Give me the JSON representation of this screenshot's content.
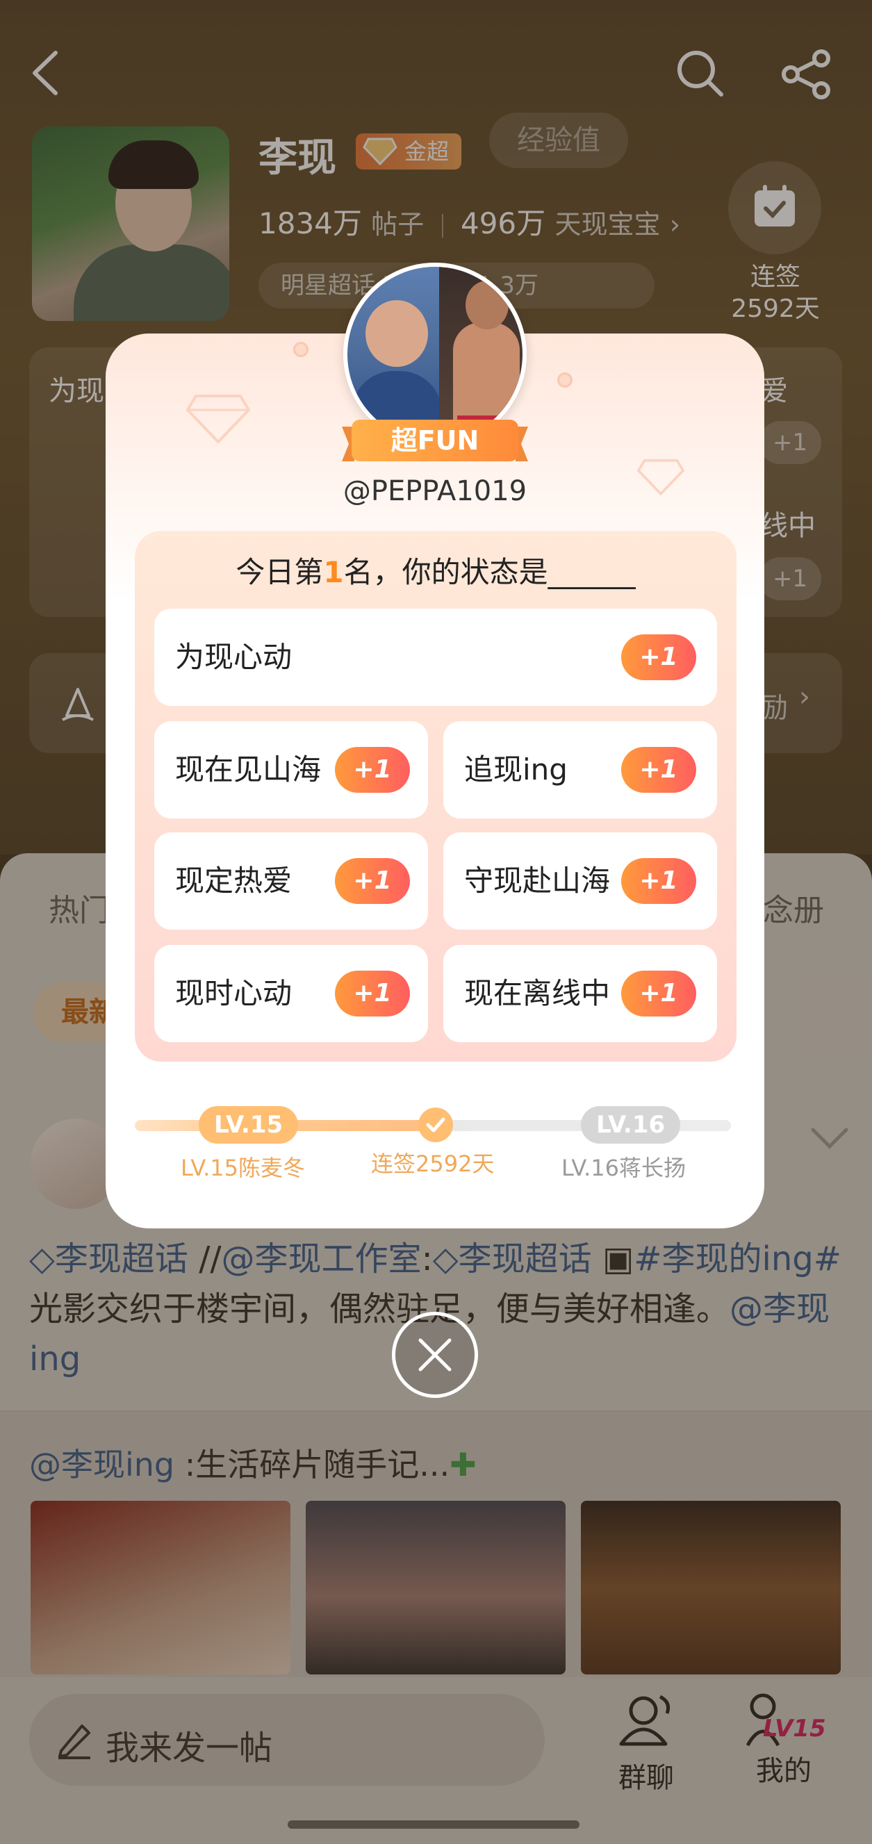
{
  "header": {
    "profile_name": "李现",
    "gold_badge": "金超",
    "exp_label": "经验值"
  },
  "stats": {
    "posts_count": "1834万",
    "posts_label": "帖子",
    "fans_count": "496万",
    "fans_label": "天现宝宝"
  },
  "tags": {
    "text": "明星超话  实时热度1.3万"
  },
  "checkin": {
    "label": "连签",
    "days": "2592天"
  },
  "background_cards": {
    "left_title": "为现",
    "right_1": "爱",
    "right_2": "线中",
    "plus": "+1",
    "activity_suffix": "励"
  },
  "feed": {
    "tab_hot": "热门",
    "tab_album": "念册",
    "pill_latest": "最新",
    "post_text_parts": [
      "李现超话",
      " //",
      "@李现工作室",
      ":",
      "李现超话",
      " ",
      "#李现的ing#",
      " 光影交织于楼宇间，偶然驻足，便与美好相逢。",
      "@李现ing"
    ],
    "repost_user": "@李现ing",
    "repost_text": " :生活碎片随手记..."
  },
  "bottom": {
    "compose_label": "我来发一帖",
    "group_chat": "群聊",
    "mine": "我的",
    "mine_level": "LV15"
  },
  "modal": {
    "badge": "超FUN",
    "handle": "@PEPPA1019",
    "title_prefix": "今日第",
    "title_rank": "1",
    "title_suffix": "名，你的状态是______",
    "options": [
      {
        "label": "为现心动",
        "plus": "+1"
      },
      {
        "label": "现在见山海",
        "plus": "+1"
      },
      {
        "label": "追现ing",
        "plus": "+1"
      },
      {
        "label": "现定热爱",
        "plus": "+1"
      },
      {
        "label": "守现赴山海",
        "plus": "+1"
      },
      {
        "label": "现时心动",
        "plus": "+1"
      },
      {
        "label": "现在离线中",
        "plus": "+1"
      }
    ],
    "level_current": "LV.15",
    "level_current_caption": "LV.15陈麦冬",
    "streak_caption": "连签2592天",
    "level_next": "LV.16",
    "level_next_caption": "LV.16蒋长扬"
  },
  "colors": {
    "accent_orange": "#ff8a1f",
    "level_orange": "#ffbe71",
    "link_blue": "#3f5f8a"
  }
}
